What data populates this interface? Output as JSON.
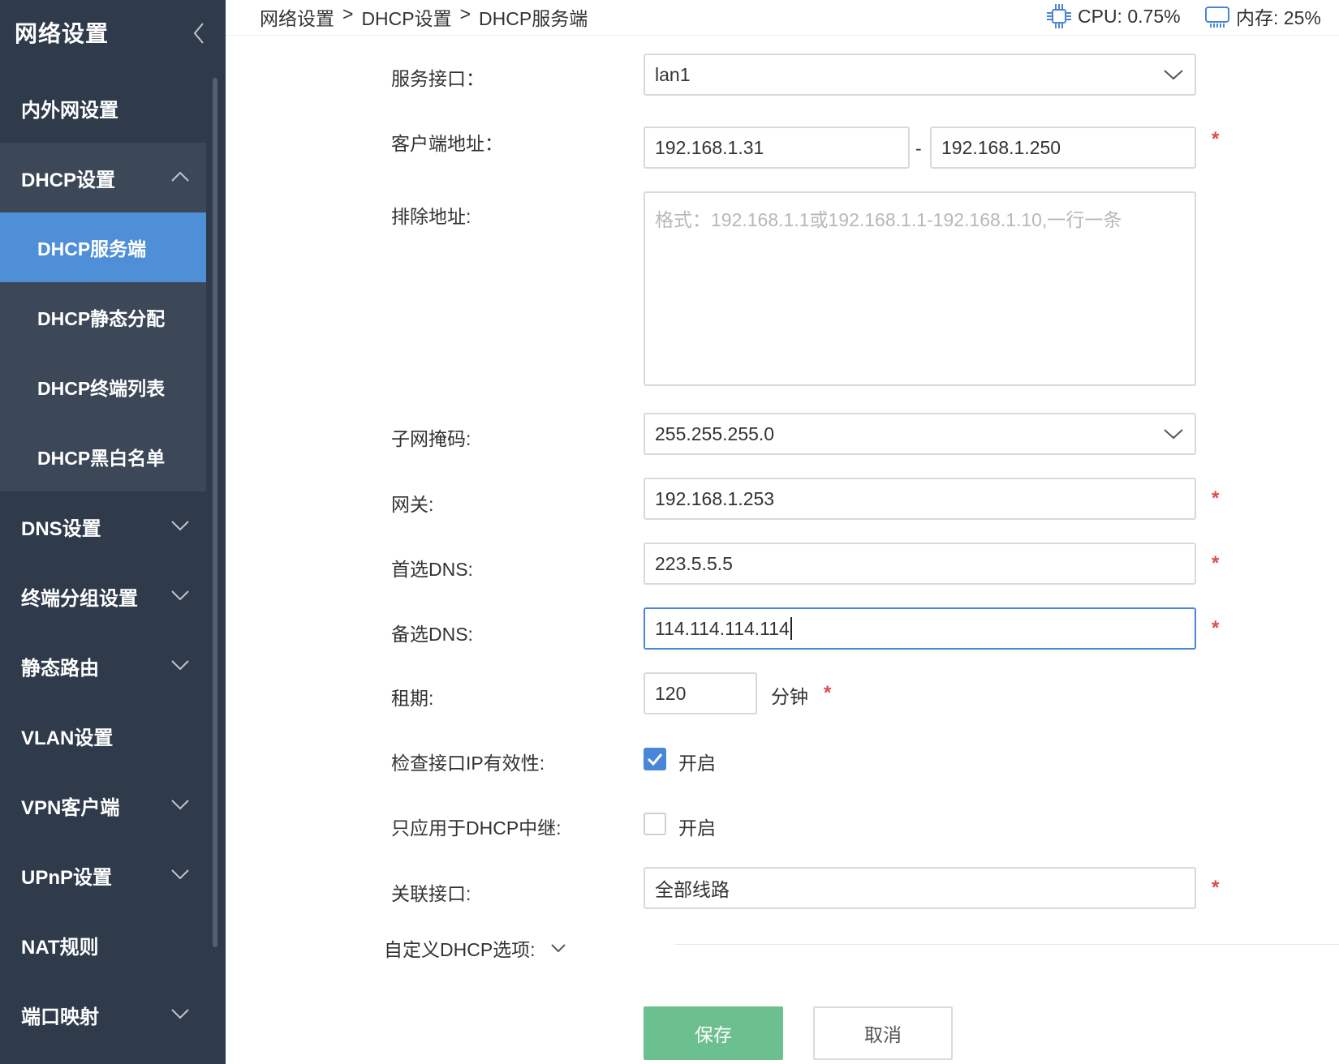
{
  "sidebar": {
    "title": "网络设置",
    "items": [
      {
        "label": "内外网设置"
      },
      {
        "label": "DHCP设置",
        "expanded": true,
        "children": [
          "DHCP服务端",
          "DHCP静态分配",
          "DHCP终端列表",
          "DHCP黑白名单"
        ],
        "active_child": "DHCP服务端"
      },
      {
        "label": "DNS设置"
      },
      {
        "label": "终端分组设置"
      },
      {
        "label": "静态路由"
      },
      {
        "label": "VLAN设置"
      },
      {
        "label": "VPN客户端"
      },
      {
        "label": "UPnP设置"
      },
      {
        "label": "NAT规则"
      },
      {
        "label": "端口映射"
      }
    ]
  },
  "breadcrumb": [
    "网络设置",
    "DHCP设置",
    "DHCP服务端"
  ],
  "breadcrumb_sep": ">",
  "status": {
    "cpu": "CPU: 0.75%",
    "mem": "内存: 25%"
  },
  "form": {
    "service_interface": {
      "label": "服务接口：",
      "value": "lan1"
    },
    "client_address": {
      "label": "客户端地址：",
      "start": "192.168.1.31",
      "dash": "-",
      "end": "192.168.1.250"
    },
    "exclude_address": {
      "label": "排除地址:",
      "placeholder": "格式：192.168.1.1或192.168.1.1-192.168.1.10,一行一条"
    },
    "subnet_mask": {
      "label": "子网掩码:",
      "value": "255.255.255.0"
    },
    "gateway": {
      "label": "网关:",
      "value": "192.168.1.253"
    },
    "primary_dns": {
      "label": "首选DNS:",
      "value": "223.5.5.5"
    },
    "secondary_dns": {
      "label": "备选DNS:",
      "value": "114.114.114.114"
    },
    "lease": {
      "label": "租期:",
      "value": "120",
      "unit": "分钟"
    },
    "check_ip": {
      "label": "检查接口IP有效性:",
      "option": "开启",
      "checked": true
    },
    "relay_only": {
      "label": "只应用于DHCP中继:",
      "option": "开启",
      "checked": false
    },
    "linked_interface": {
      "label": "关联接口:",
      "value": "全部线路"
    },
    "custom_options": {
      "label": "自定义DHCP选项:"
    },
    "required_mark": "*"
  },
  "buttons": {
    "save": "保存",
    "cancel": "取消"
  },
  "colors": {
    "sidebar_bg": "#2f3a4b",
    "submenu_bg": "#3c4758",
    "active": "#4f8fd8",
    "required": "#e04b4b",
    "save_btn": "#6cc08f",
    "checkbox_on": "#4a86d8"
  }
}
